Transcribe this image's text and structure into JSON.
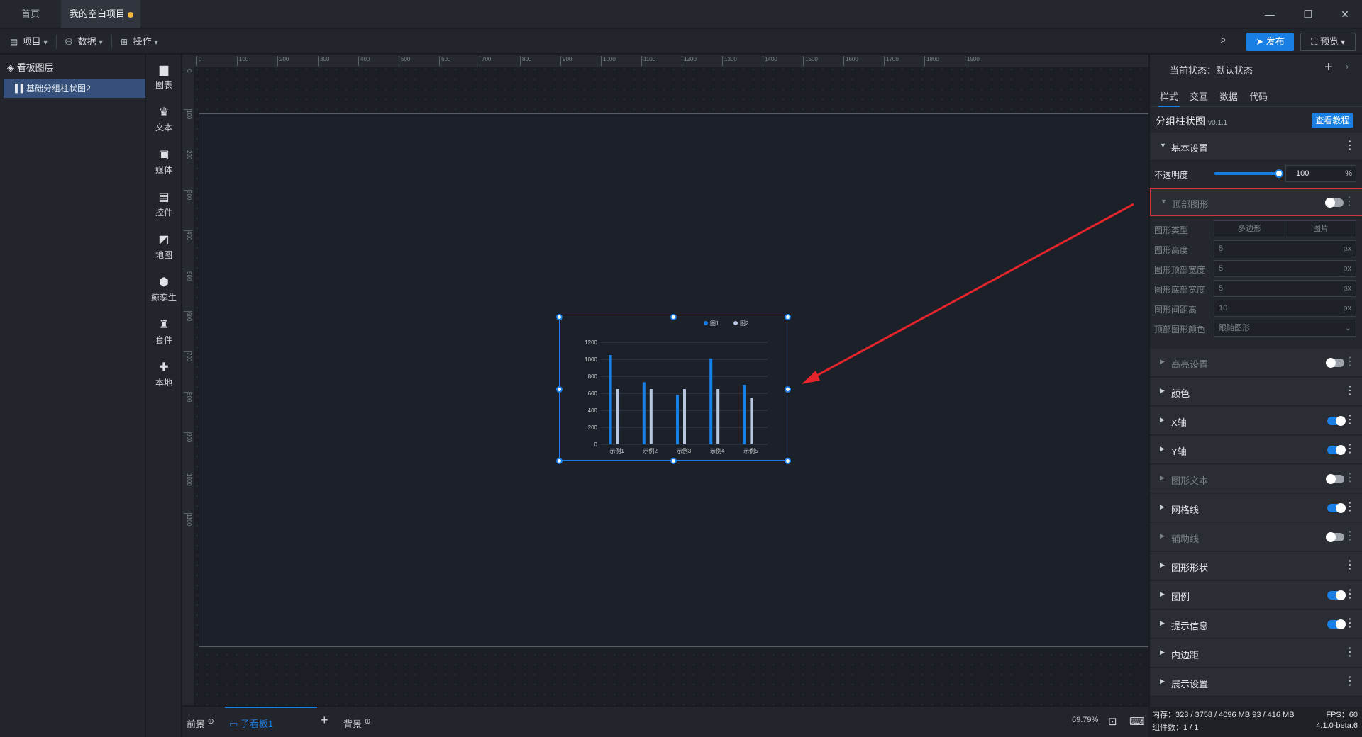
{
  "titlebar": {
    "tab_home": "首页",
    "tab_project": "我的空白项目"
  },
  "toolbar": {
    "menu_project": "项目",
    "menu_data": "数据",
    "menu_operation": "操作",
    "publish": "发布",
    "preview": "预览"
  },
  "layers": {
    "title": "看板图层",
    "items": [
      {
        "label": "基础分组柱状图2"
      }
    ]
  },
  "tools": [
    {
      "label": "图表",
      "icon": "bar-chart-icon"
    },
    {
      "label": "文本",
      "icon": "text-icon"
    },
    {
      "label": "媒体",
      "icon": "media-icon"
    },
    {
      "label": "控件",
      "icon": "control-icon"
    },
    {
      "label": "地图",
      "icon": "map-icon"
    },
    {
      "label": "鲸孪生",
      "icon": "twin-icon"
    },
    {
      "label": "套件",
      "icon": "kit-icon"
    },
    {
      "label": "本地",
      "icon": "local-icon"
    }
  ],
  "ruler_top": [
    "0",
    "100",
    "200",
    "300",
    "400",
    "500",
    "600",
    "700",
    "800",
    "900",
    "1000",
    "1100",
    "1200",
    "1300",
    "1400",
    "1500",
    "1600",
    "1700",
    "1800",
    "1900"
  ],
  "ruler_left": [
    "0",
    "100",
    "200",
    "300",
    "400",
    "500",
    "600",
    "700",
    "800",
    "900",
    "1000",
    "1100"
  ],
  "chart_data": {
    "type": "bar",
    "categories": [
      "示例1",
      "示例2",
      "示例3",
      "示例4",
      "示例5"
    ],
    "series": [
      {
        "name": "图1",
        "values": [
          1050,
          730,
          580,
          1010,
          700
        ],
        "color": "#1a7fe4"
      },
      {
        "name": "图2",
        "values": [
          650,
          650,
          650,
          650,
          550
        ],
        "color": "#b8c7e0"
      }
    ],
    "yticks": [
      "0",
      "200",
      "400",
      "600",
      "800",
      "1000",
      "1200"
    ],
    "ylim": [
      0,
      1200
    ],
    "legend": "top-right",
    "grid": true
  },
  "bottombar": {
    "foreground": "前景",
    "subboard": "子看板1",
    "background": "背景",
    "zoom": "69.79%"
  },
  "props": {
    "state_label": "当前状态：默认状态",
    "tabs": [
      "样式",
      "交互",
      "数据",
      "代码"
    ],
    "component_title": "分组柱状图",
    "component_version": "v0.1.1",
    "tutorial": "查看教程",
    "basic_settings": "基本设置",
    "opacity_label": "不透明度",
    "opacity_value": "100",
    "opacity_unit": "%",
    "top_shape": "顶部图形",
    "fields": [
      {
        "label": "图形类型"
      },
      {
        "label": "图形高度",
        "value": "5",
        "unit": "px"
      },
      {
        "label": "图形顶部宽度",
        "value": "5",
        "unit": "px"
      },
      {
        "label": "图形底部宽度",
        "value": "5",
        "unit": "px"
      },
      {
        "label": "图形间距离",
        "value": "10",
        "unit": "px"
      },
      {
        "label": "顶部图形颜色",
        "value": "跟随图形"
      }
    ],
    "shape_type_options": [
      "多边形",
      "图片"
    ],
    "sections": [
      {
        "label": "高亮设置",
        "toggle": "off",
        "dim": true
      },
      {
        "label": "颜色"
      },
      {
        "label": "X轴",
        "toggle": "on"
      },
      {
        "label": "Y轴",
        "toggle": "on"
      },
      {
        "label": "图形文本",
        "toggle": "off",
        "dim": true
      },
      {
        "label": "网格线",
        "toggle": "on"
      },
      {
        "label": "辅助线",
        "toggle": "off",
        "dim": true
      },
      {
        "label": "图形形状"
      },
      {
        "label": "图例",
        "toggle": "on"
      },
      {
        "label": "提示信息",
        "toggle": "on"
      },
      {
        "label": "内边距"
      },
      {
        "label": "展示设置"
      }
    ]
  },
  "footer": {
    "memory": "内存：323 / 3758 / 4096 MB  93 / 416 MB",
    "fps": "FPS：60",
    "components": "组件数：1 / 1",
    "version": "4.1.0-beta.6"
  }
}
